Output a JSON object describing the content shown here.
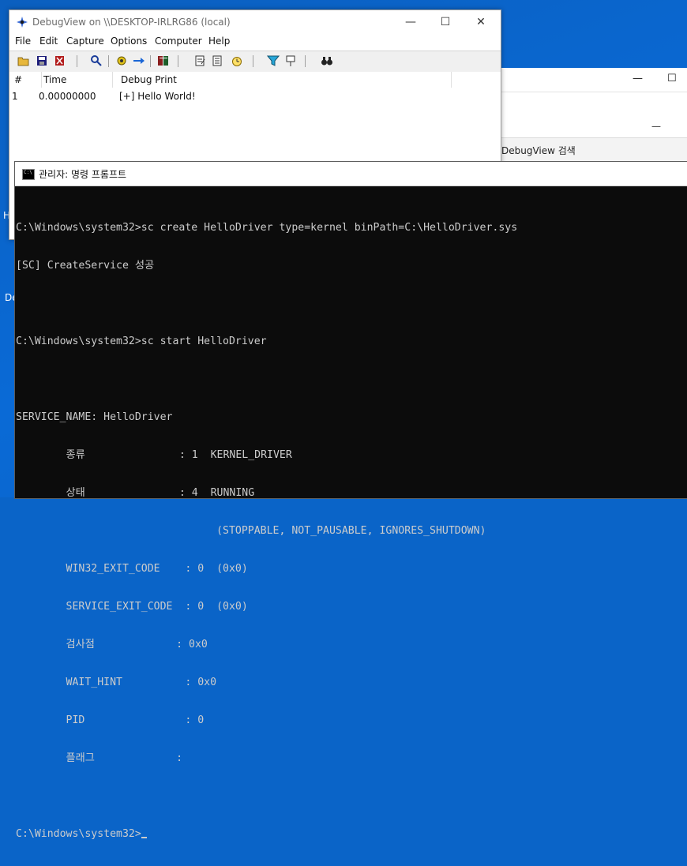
{
  "desktop": {
    "left_labels": [
      "H",
      "De"
    ]
  },
  "bg_window": {
    "min_btn": "—",
    "max_btn": "☐",
    "inner_min": "—",
    "search_text": "DebugView 검색"
  },
  "debugview": {
    "title": "DebugView on \\\\DESKTOP-IRLRG86 (local)",
    "buttons": {
      "minimize": "—",
      "maximize": "☐",
      "close": "✕"
    },
    "menu": [
      "File",
      "Edit",
      "Capture",
      "Options",
      "Computer",
      "Help"
    ],
    "toolbar_icons": [
      "open-icon",
      "save-icon",
      "clear-icon",
      "find-icon",
      "capture-icon",
      "arrow-right-icon",
      "log-icon",
      "filter-icon",
      "highlight-icon",
      "clock-icon",
      "funnel-icon",
      "pin-icon",
      "binoculars-icon"
    ],
    "columns": [
      "#",
      "Time",
      "Debug Print"
    ],
    "rows": [
      {
        "num": "1",
        "time": "0.00000000",
        "msg": "[+] Hello World!"
      }
    ]
  },
  "cmd": {
    "title": "관리자: 명령 프롬프트",
    "lines": [
      "C:\\Windows\\system32>sc create HelloDriver type=kernel binPath=C:\\HelloDriver.sys",
      "[SC] CreateService 성공",
      "",
      "C:\\Windows\\system32>sc start HelloDriver",
      "",
      "SERVICE_NAME: HelloDriver",
      "        종류               : 1  KERNEL_DRIVER",
      "        상태               : 4  RUNNING",
      "                                (STOPPABLE, NOT_PAUSABLE, IGNORES_SHUTDOWN)",
      "        WIN32_EXIT_CODE    : 0  (0x0)",
      "        SERVICE_EXIT_CODE  : 0  (0x0)",
      "        검사점             : 0x0",
      "        WAIT_HINT          : 0x0",
      "        PID                : 0",
      "        플래그             :",
      ""
    ],
    "prompt": "C:\\Windows\\system32>"
  }
}
